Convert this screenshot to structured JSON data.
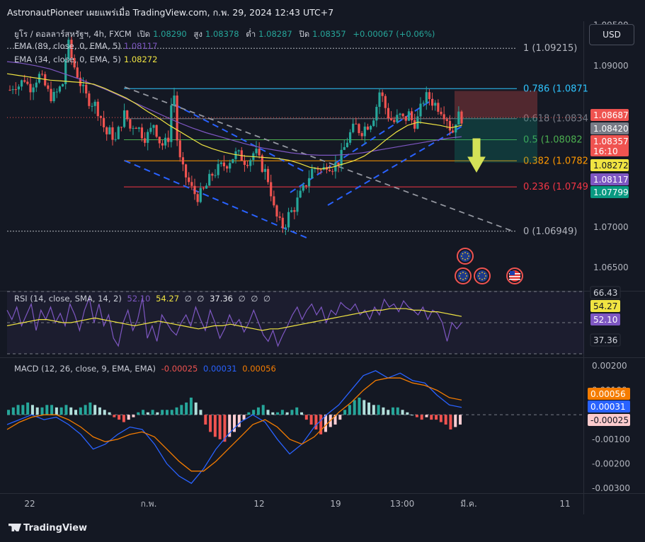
{
  "header": {
    "title": "AstronautPioneer เผยแพร่เมื่อ TradingView.com, ก.พ. 29, 2024 12:43 UTC+7"
  },
  "legend": {
    "symbol": "ยูโร / ดอลลาร์สหรัฐฯ, 4h, FXCM",
    "open_label": "เปิด",
    "open": "1.08290",
    "high_label": "สูง",
    "high": "1.08378",
    "low_label": "ต่ำ",
    "low": "1.08287",
    "close_label": "ปิด",
    "close": "1.08357",
    "change": "+0.00067 (+0.06%)",
    "ema89_label": "EMA (89, close, 0, EMA, 5)",
    "ema89_value": "1.08117",
    "ema34_label": "EMA (34, close, 0, EMA, 5)",
    "ema34_value": "1.08272",
    "rsi_label": "RSI (14, close, SMA, 14, 2)",
    "rsi_value": "52.10",
    "rsi_ma": "54.27",
    "rsi_na1": "∅",
    "rsi_na2": "∅",
    "rsi_low": "37.36",
    "rsi_na3": "∅",
    "rsi_na4": "∅",
    "rsi_na5": "∅",
    "macd_label": "MACD (12, 26, close, 9, EMA, EMA)",
    "macd_hist": "-0.00025",
    "macd_line": "0.00031",
    "macd_signal": "0.00056"
  },
  "currency_button": "USD",
  "watermark": "TradingView",
  "colors": {
    "bg": "#141823",
    "up": "#26a69a",
    "down": "#ef5350",
    "ema34": "#f0e442",
    "ema89": "#7e57c2",
    "macd": "#2962ff",
    "signal": "#f57c00",
    "rsi": "#7e57c2",
    "rsi_ma": "#f0e442"
  },
  "chart_data": [
    {
      "type": "candlestick",
      "title": "ยูโร / ดอลลาร์สหรัฐฯ, 4h, FXCM",
      "ylim": [
        1.0622,
        1.0955
      ],
      "y_ticks": [
        "1.09500",
        "1.09000",
        "1.06500",
        "1.07000"
      ],
      "x_ticks": [
        "22",
        "ก.พ.",
        "12",
        "19",
        "13:00",
        "มี.ค.",
        "11"
      ],
      "price_path": [
        1.087,
        1.0878,
        1.0875,
        1.0885,
        1.0872,
        1.088,
        1.0888,
        1.0879,
        1.0866,
        1.086,
        1.0868,
        1.0878,
        1.093,
        1.0905,
        1.089,
        1.0872,
        1.086,
        1.0855,
        1.085,
        1.0835,
        1.0815,
        1.0818,
        1.0806,
        1.0828,
        1.0842,
        1.0822,
        1.083,
        1.082,
        1.0812,
        1.0815,
        1.083,
        1.0808,
        1.08,
        1.0812,
        1.088,
        1.079,
        1.077,
        1.0758,
        1.0745,
        1.0738,
        1.0742,
        1.0752,
        1.0765,
        1.077,
        1.0775,
        1.0778,
        1.0785,
        1.079,
        1.0788,
        1.0782,
        1.0785,
        1.0795,
        1.078,
        1.077,
        1.0755,
        1.072,
        1.0705,
        1.07,
        1.0715,
        1.0722,
        1.0735,
        1.0745,
        1.076,
        1.0772,
        1.0775,
        1.0768,
        1.078,
        1.0775,
        1.0778,
        1.0788,
        1.0805,
        1.0818,
        1.0825,
        1.0818,
        1.0825,
        1.083,
        1.0842,
        1.087,
        1.085,
        1.0835,
        1.083,
        1.0838,
        1.0832,
        1.084,
        1.0828,
        1.0835,
        1.0858,
        1.0862,
        1.0855,
        1.085,
        1.0845,
        1.0835,
        1.0815,
        1.0838,
        1.0836
      ],
      "ema34": [
        1.089,
        1.0888,
        1.0886,
        1.0884,
        1.0882,
        1.0881,
        1.088,
        1.0879,
        1.0877,
        1.0872,
        1.0866,
        1.086,
        1.0852,
        1.0843,
        1.0835,
        1.0826,
        1.0818,
        1.081,
        1.0802,
        1.0797,
        1.0793,
        1.079,
        1.0788,
        1.0787,
        1.0786,
        1.0785,
        1.0783,
        1.0779,
        1.0774,
        1.0772,
        1.0774,
        1.0778,
        1.0782,
        1.0788,
        1.0797,
        1.0808,
        1.0818,
        1.0826,
        1.083,
        1.0828,
        1.0826,
        1.0823,
        1.0826
      ],
      "ema89": [
        1.0905,
        1.0903,
        1.09,
        1.0896,
        1.089,
        1.0884,
        1.0877,
        1.087,
        1.0862,
        1.0854,
        1.0846,
        1.0838,
        1.083,
        1.0823,
        1.0817,
        1.0812,
        1.0807,
        1.0802,
        1.0798,
        1.0795,
        1.0792,
        1.079,
        1.0789,
        1.0789,
        1.079,
        1.0792,
        1.0795,
        1.0798,
        1.0801,
        1.0804,
        1.0807,
        1.081,
        1.0812
      ],
      "fib_levels": [
        {
          "label": "1 (1.09215)",
          "value": 1.09215,
          "color": "#b2b5be"
        },
        {
          "label": "0.786 (1.0871",
          "value": 1.08715,
          "color": "#2ec5ff"
        },
        {
          "label": "0.618 (1.0834",
          "value": 1.08343,
          "color": "#787b86"
        },
        {
          "label": "0.5 (1.08082",
          "value": 1.08082,
          "color": "#4caf50"
        },
        {
          "label": "0.382 (1.0782",
          "value": 1.07821,
          "color": "#ff9800"
        },
        {
          "label": "0.236 (1.0749",
          "value": 1.07498,
          "color": "#f23645"
        },
        {
          "label": "0 (1.06949)",
          "value": 1.06949,
          "color": "#b2b5be"
        }
      ],
      "price_labels": [
        {
          "text": "1.08687",
          "value": 1.08687,
          "bg": "#ef5350",
          "fg": "#ffffff"
        },
        {
          "text": "1.08420",
          "value": 1.0842,
          "bg": "#787b86",
          "fg": "#ffffff"
        },
        {
          "text": "1.08357",
          "value": 1.08357,
          "bg": "#ef5350",
          "fg": "#ffffff",
          "sub": "16:10"
        },
        {
          "text": "1.08272",
          "value": 1.08272,
          "bg": "#f0e442",
          "fg": "#131722"
        },
        {
          "text": "1.08117",
          "value": 1.08117,
          "bg": "#7e57c2",
          "fg": "#ffffff"
        },
        {
          "text": "1.07799",
          "value": 1.07799,
          "bg": "#089981",
          "fg": "#ffffff"
        }
      ],
      "target_zone": {
        "entry": 1.08357,
        "stop": 1.08687,
        "target": 1.07799
      },
      "event_icons": [
        "eu-flag-icon",
        "eu-flag-icon",
        "eu-flag-icon",
        "us-flag-icon"
      ]
    },
    {
      "type": "line",
      "title": "RSI (14, close, SMA, 14, 2)",
      "ylim": [
        30,
        70
      ],
      "y_labels": [
        {
          "text": "66.43",
          "value": 66.43,
          "bg": "#141823",
          "fg": "#d1d4dc"
        },
        {
          "text": "54.27",
          "value": 56.0,
          "bg": "#f0e442",
          "fg": "#131722"
        },
        {
          "text": "52.10",
          "value": 48.5,
          "bg": "#7e57c2",
          "fg": "#ffffff"
        },
        {
          "text": "37.36",
          "value": 37.36,
          "bg": "#141823",
          "fg": "#d1d4dc"
        }
      ],
      "rsi": [
        58,
        52,
        60,
        48,
        55,
        62,
        45,
        58,
        52,
        60,
        50,
        56,
        48,
        62,
        55,
        45,
        58,
        66,
        50,
        62,
        48,
        55,
        40,
        35,
        50,
        58,
        45,
        52,
        66,
        40,
        48,
        38,
        55,
        50,
        45,
        42,
        50,
        55,
        48,
        60,
        52,
        45,
        58,
        50,
        40,
        46,
        55,
        48,
        52,
        44,
        50,
        58,
        50,
        42,
        38,
        45,
        35,
        42,
        48,
        55,
        60,
        52,
        58,
        62,
        55,
        60,
        50,
        58,
        55,
        63,
        60,
        58,
        62,
        55,
        58,
        52,
        60,
        55,
        65,
        60,
        62,
        57,
        64,
        60,
        58,
        55,
        60,
        52,
        58,
        56,
        50,
        38,
        50,
        46,
        50
      ],
      "rsi_ma": [
        48,
        49,
        50,
        51,
        52,
        52,
        51,
        50,
        50,
        51,
        52,
        53,
        52,
        51,
        50,
        49,
        48,
        49,
        50,
        51,
        50,
        49,
        48,
        47,
        46,
        47,
        48,
        48,
        49,
        48,
        47,
        46,
        45,
        46,
        46,
        47,
        48,
        49,
        50,
        51,
        52,
        53,
        54,
        55,
        56,
        57,
        58,
        58,
        59,
        59,
        59,
        58,
        58,
        57,
        57,
        56,
        55,
        54
      ],
      "ref_lines": [
        70,
        50,
        30
      ]
    },
    {
      "type": "bar",
      "title": "MACD (12, 26, close, 9, EMA, EMA)",
      "ylim": [
        -0.0032,
        0.0022
      ],
      "y_ticks": [
        "0.00200",
        "0.00100",
        "-0.00100",
        "-0.00200",
        "-0.00300"
      ],
      "y_labels": [
        {
          "text": "0.00056",
          "value": 0.00056,
          "bg": "#f57c00",
          "fg": "#ffffff"
        },
        {
          "text": "0.00031",
          "value": 0.00031,
          "bg": "#2962ff",
          "fg": "#ffffff"
        },
        {
          "text": "-0.00025",
          "value": -0.00025,
          "bg": "#fccbcd",
          "fg": "#131722"
        }
      ],
      "histogram": [
        0.0002,
        0.0003,
        0.0004,
        0.0004,
        0.0005,
        0.0004,
        0.0003,
        0.0003,
        0.0004,
        0.0004,
        0.0003,
        0.0003,
        0.0004,
        0.0003,
        0.0002,
        0.0003,
        0.0004,
        0.0005,
        0.0004,
        0.0003,
        0.0002,
        0.0001,
        -0.0001,
        -0.0002,
        -0.0003,
        -0.0002,
        -0.0001,
        0.0001,
        0.0002,
        0.0001,
        0.0002,
        0.0001,
        0.0002,
        0.0002,
        0.0002,
        0.0003,
        0.0004,
        0.0005,
        0.0007,
        0.0005,
        0.0002,
        -0.0004,
        -0.0007,
        -0.0009,
        -0.001,
        -0.0011,
        -0.0009,
        -0.0007,
        -0.0005,
        -0.0002,
        0.0001,
        0.0002,
        0.0003,
        0.0004,
        0.0002,
        0.0001,
        0.0001,
        0.0002,
        0.0001,
        0.0002,
        0.0003,
        0.0001,
        -0.0002,
        -0.0004,
        -0.0006,
        -0.0008,
        -0.0007,
        -0.0005,
        -0.0004,
        -0.0002,
        0.0002,
        0.0004,
        0.0006,
        0.0007,
        0.0006,
        0.0005,
        0.0004,
        0.0004,
        0.0003,
        0.0002,
        0.0003,
        0.0003,
        0.0002,
        0.0001,
        0.0,
        -0.0001,
        -0.0002,
        -0.0001,
        -0.0002,
        -0.0002,
        -0.0003,
        -0.0004,
        -0.0006,
        -0.0005,
        -0.0004
      ],
      "macd": [
        -0.0004,
        -0.0002,
        0.0,
        -0.0002,
        -0.0001,
        -0.0004,
        -0.0008,
        -0.0014,
        -0.0012,
        -0.0008,
        -0.0005,
        -0.0006,
        -0.0012,
        -0.002,
        -0.0025,
        -0.0028,
        -0.0022,
        -0.0014,
        -0.0008,
        -0.0003,
        0.0,
        -0.0003,
        -0.001,
        -0.0016,
        -0.0012,
        -0.0005,
        0.0,
        0.0004,
        0.001,
        0.0016,
        0.0018,
        0.0015,
        0.0017,
        0.0014,
        0.0013,
        0.0008,
        0.0004,
        0.0003
      ],
      "signal": [
        -0.0006,
        -0.0003,
        -0.0001,
        0.0,
        0.0,
        -0.0002,
        -0.0005,
        -0.0009,
        -0.0011,
        -0.001,
        -0.0008,
        -0.0007,
        -0.0009,
        -0.0014,
        -0.0019,
        -0.0023,
        -0.0023,
        -0.0019,
        -0.0014,
        -0.0009,
        -0.0004,
        -0.0002,
        -0.0005,
        -0.001,
        -0.0012,
        -0.0009,
        -0.0004,
        0.0001,
        0.0005,
        0.001,
        0.0014,
        0.0015,
        0.0015,
        0.0013,
        0.0012,
        0.001,
        0.0007,
        0.0006
      ]
    }
  ]
}
